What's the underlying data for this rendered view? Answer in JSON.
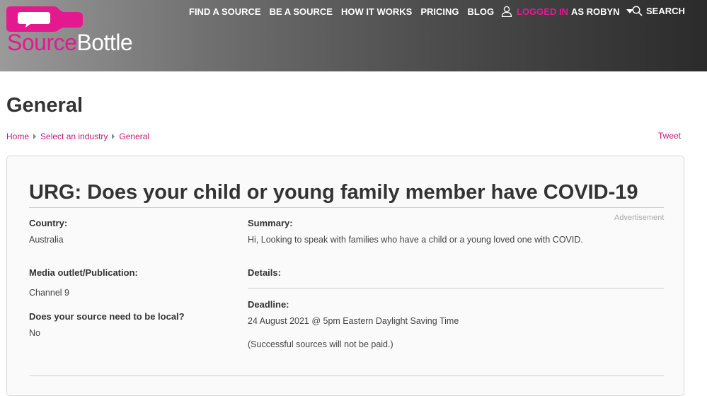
{
  "brand": {
    "logo_part1": "Source",
    "logo_part2": "Bottle",
    "pink": "#e5198f"
  },
  "nav": {
    "items": [
      "FIND A SOURCE",
      "BE A SOURCE",
      "HOW IT WORKS",
      "PRICING",
      "BLOG"
    ],
    "logged_in": "LOGGED IN",
    "as_user": "AS ROBYN",
    "search_label": "SEARCH",
    "user_icon": "user-icon",
    "search_icon": "search-icon"
  },
  "page": {
    "title": "General",
    "breadcrumb": [
      "Home",
      "Select an industry",
      "General"
    ],
    "tweet": "Tweet"
  },
  "request": {
    "title": "URG: Does your child or young family member have COVID-19",
    "advertisement": "Advertisement",
    "country_label": "Country:",
    "country": "Australia",
    "outlet_label": "Media outlet/Publication:",
    "outlet": "Channel 9",
    "local_label": "Does your source need to be local?",
    "local": "No",
    "summary_label": "Summary:",
    "summary": "Hi, Looking to speak with families who have a child or a young loved one with COVID.",
    "details_label": "Details:",
    "deadline_label": "Deadline:",
    "deadline": "24 August 2021 @ 5pm Eastern Daylight Saving Time",
    "note": "(Successful sources will not be paid.)"
  }
}
